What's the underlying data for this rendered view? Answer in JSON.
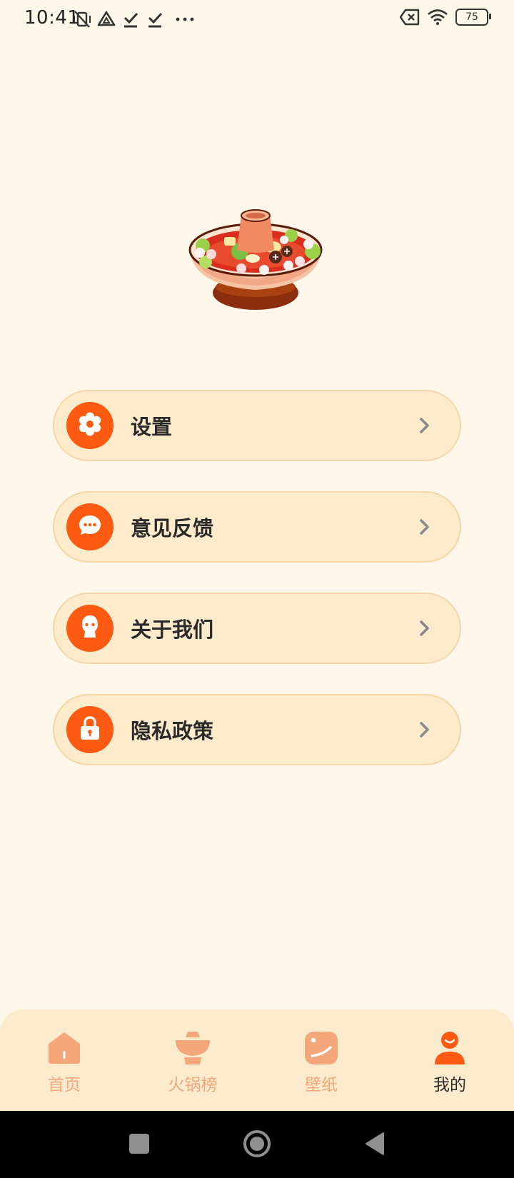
{
  "status_bar": {
    "time": "10:41",
    "battery": "75",
    "icons": [
      "vibrate-off-icon",
      "drive-icon",
      "download-done-icon",
      "download-done-icon",
      "more-dots-icon",
      "data-off-icon",
      "wifi-icon",
      "battery-icon"
    ]
  },
  "hero": {
    "image": "hotpot-illustration"
  },
  "menu": {
    "items": [
      {
        "label": "设置",
        "icon": "gear-icon"
      },
      {
        "label": "意见反馈",
        "icon": "chat-bubble-icon"
      },
      {
        "label": "关于我们",
        "icon": "person-face-icon"
      },
      {
        "label": "隐私政策",
        "icon": "lock-icon"
      }
    ]
  },
  "tabbar": {
    "tabs": [
      {
        "label": "首页",
        "icon": "home-icon",
        "active": false
      },
      {
        "label": "火锅榜",
        "icon": "hotpot-icon",
        "active": false
      },
      {
        "label": "壁纸",
        "icon": "wallpaper-icon",
        "active": false
      },
      {
        "label": "我的",
        "icon": "profile-icon",
        "active": true
      }
    ]
  },
  "colors": {
    "background": "#fff7e9",
    "accent": "#ff5a12",
    "card": "#fdebcb",
    "card_border": "#f3d7aa",
    "tab_inactive": "#f3a77a"
  }
}
